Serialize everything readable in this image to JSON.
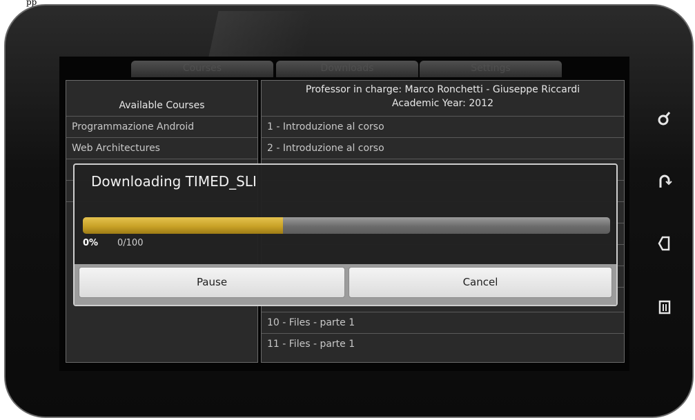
{
  "top_text": "pp",
  "tabs": [
    {
      "label": "Courses"
    },
    {
      "label": "Downloads"
    },
    {
      "label": "Settings"
    }
  ],
  "left_panel": {
    "header": "Available Courses",
    "items": [
      {
        "label": "Programmazione Android"
      },
      {
        "label": "Web Architectures"
      }
    ]
  },
  "right_panel": {
    "header_line1": "Professor in charge: Marco Ronchetti - Giuseppe Riccardi",
    "header_line2": "Academic Year: 2012",
    "items": [
      {
        "label": "1 - Introduzione al corso"
      },
      {
        "label": "2 - Introduzione al corso"
      },
      {
        "label": "10 - Files - parte 1"
      },
      {
        "label": "11 - Files - parte 1"
      }
    ]
  },
  "dialog": {
    "title": "Downloading TIMED_SLIDES",
    "progress_fraction": 0.38,
    "percent_text": "0%",
    "count_text": "0/100",
    "pause_label": "Pause",
    "cancel_label": "Cancel"
  },
  "side_icons": [
    "search-icon",
    "home-icon",
    "back-icon",
    "menu-icon"
  ]
}
